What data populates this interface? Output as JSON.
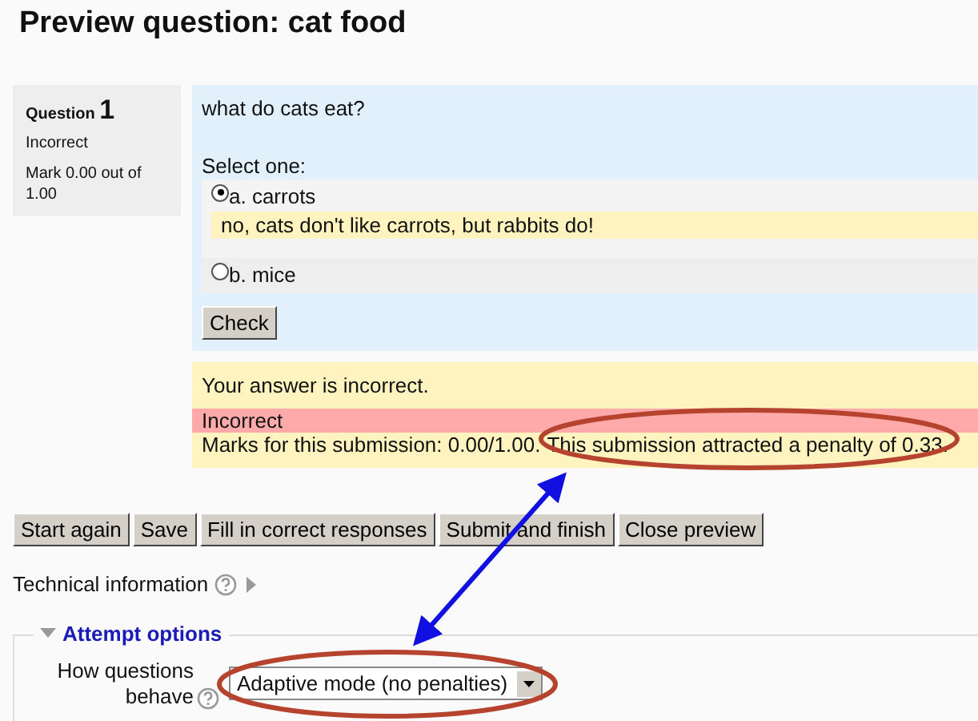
{
  "title": "Preview question: cat food",
  "info": {
    "label": "Question",
    "number": "1",
    "state": "Incorrect",
    "mark": "Mark 0.00 out of 1.00"
  },
  "question": {
    "text": "what do cats eat?",
    "prompt": "Select one:",
    "answers": [
      {
        "label": "a. carrots",
        "selected": true,
        "feedback": "no, cats don't like carrots, but rabbits do!"
      },
      {
        "label": "b. mice",
        "selected": false
      }
    ],
    "check": "Check"
  },
  "feedback": {
    "general": "Your answer is incorrect.",
    "state": "Incorrect",
    "marks": "Marks for this submission: 0.00/1.00.",
    "penalty": "This submission attracted a penalty of 0.33."
  },
  "buttons": [
    "Start again",
    "Save",
    "Fill in correct responses",
    "Submit and finish",
    "Close preview"
  ],
  "technical": {
    "label": "Technical information",
    "expanded": false
  },
  "attempt_options": {
    "legend": "Attempt options",
    "expanded": true,
    "field_label": "How questions behave",
    "value": "Adaptive mode (no penalties)"
  }
}
